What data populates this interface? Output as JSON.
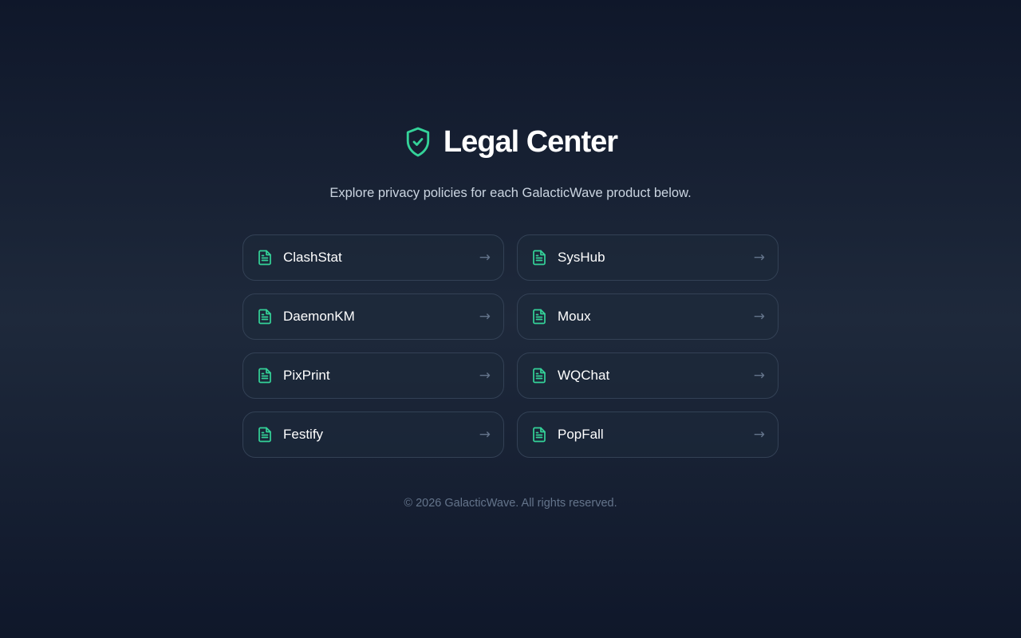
{
  "header": {
    "title": "Legal Center",
    "icon": "shield-check-icon",
    "accent_color": "#34d399"
  },
  "subtitle": "Explore privacy policies for each GalacticWave product below.",
  "products": [
    {
      "label": "ClashStat",
      "icon": "document-icon",
      "arrow": "→"
    },
    {
      "label": "SysHub",
      "icon": "document-icon",
      "arrow": "→"
    },
    {
      "label": "DaemonKM",
      "icon": "document-icon",
      "arrow": "→"
    },
    {
      "label": "Moux",
      "icon": "document-icon",
      "arrow": "→"
    },
    {
      "label": "PixPrint",
      "icon": "document-icon",
      "arrow": "→"
    },
    {
      "label": "WQChat",
      "icon": "document-icon",
      "arrow": "→"
    },
    {
      "label": "Festify",
      "icon": "document-icon",
      "arrow": "→"
    },
    {
      "label": "PopFall",
      "icon": "document-icon",
      "arrow": "→"
    }
  ],
  "footer": "© 2026 GalacticWave. All rights reserved."
}
